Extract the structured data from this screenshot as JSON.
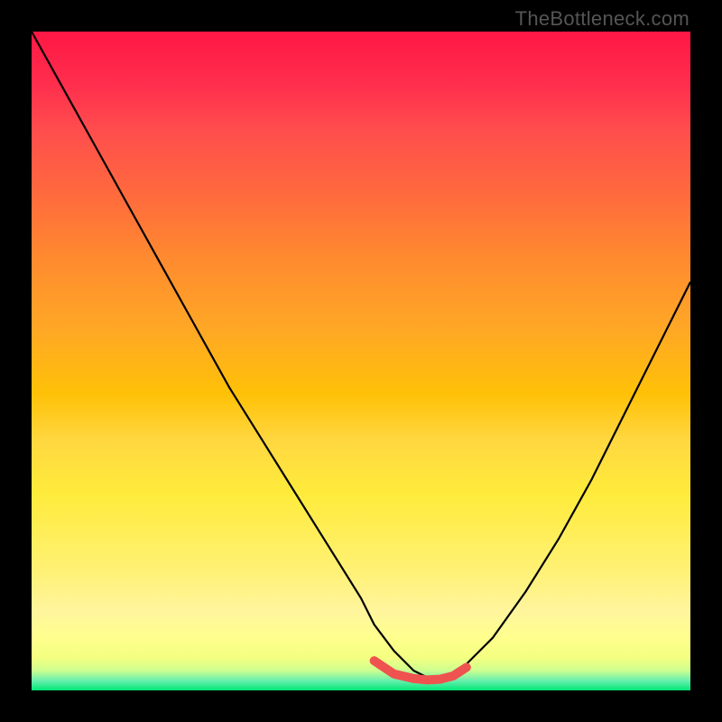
{
  "watermark": "TheBottleneck.com",
  "chart_data": {
    "type": "line",
    "title": "",
    "xlabel": "",
    "ylabel": "",
    "xlim": [
      0,
      100
    ],
    "ylim": [
      0,
      100
    ],
    "grid": false,
    "legend": false,
    "series": [
      {
        "name": "bottleneck-curve",
        "color": "#000000",
        "x": [
          0,
          5,
          10,
          15,
          20,
          25,
          30,
          35,
          40,
          45,
          50,
          52,
          55,
          58,
          60,
          62,
          65,
          70,
          75,
          80,
          85,
          90,
          95,
          100
        ],
        "y": [
          100,
          91,
          82,
          73,
          64,
          55,
          46,
          38,
          30,
          22,
          14,
          10,
          6,
          3,
          2,
          2,
          3,
          8,
          15,
          23,
          32,
          42,
          52,
          62
        ]
      },
      {
        "name": "optimal-zone",
        "color": "#ef5350",
        "x": [
          52,
          55,
          58,
          60,
          62,
          64,
          66
        ],
        "y": [
          4.5,
          2.5,
          1.8,
          1.6,
          1.7,
          2.2,
          3.5
        ]
      }
    ],
    "background_gradient": {
      "stops": [
        {
          "pos": 0,
          "color": "#ff1744"
        },
        {
          "pos": 0.25,
          "color": "#ff6b3d"
        },
        {
          "pos": 0.55,
          "color": "#ffc107"
        },
        {
          "pos": 0.82,
          "color": "#fff176"
        },
        {
          "pos": 0.97,
          "color": "#ccff90"
        },
        {
          "pos": 1.0,
          "color": "#00e676"
        }
      ]
    }
  }
}
